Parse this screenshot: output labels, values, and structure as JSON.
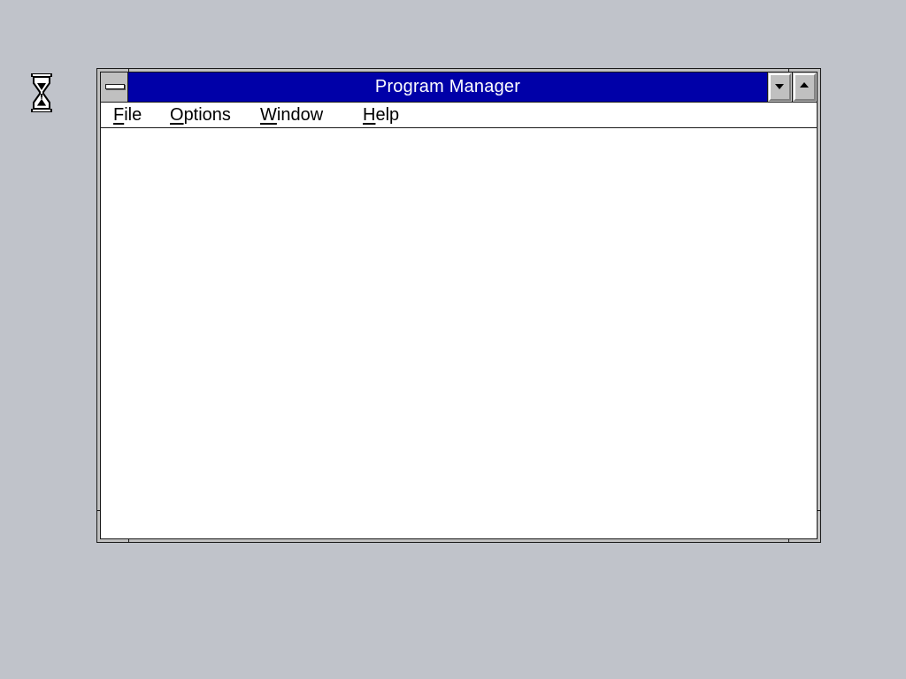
{
  "desktop": {
    "background_color": "#c0c3ca",
    "cursor_icon": "hourglass-icon"
  },
  "window": {
    "title": "Program Manager",
    "titlebar_color": "#0000a8",
    "system_menu_icon": "system-menu-icon",
    "minimize_icon": "minimize-arrow-icon",
    "maximize_icon": "maximize-arrow-icon"
  },
  "menubar": {
    "items": [
      {
        "mnemonic": "F",
        "rest": "ile"
      },
      {
        "mnemonic": "O",
        "rest": "ptions"
      },
      {
        "mnemonic": "W",
        "rest": "indow"
      },
      {
        "mnemonic": "H",
        "rest": "elp"
      }
    ]
  }
}
